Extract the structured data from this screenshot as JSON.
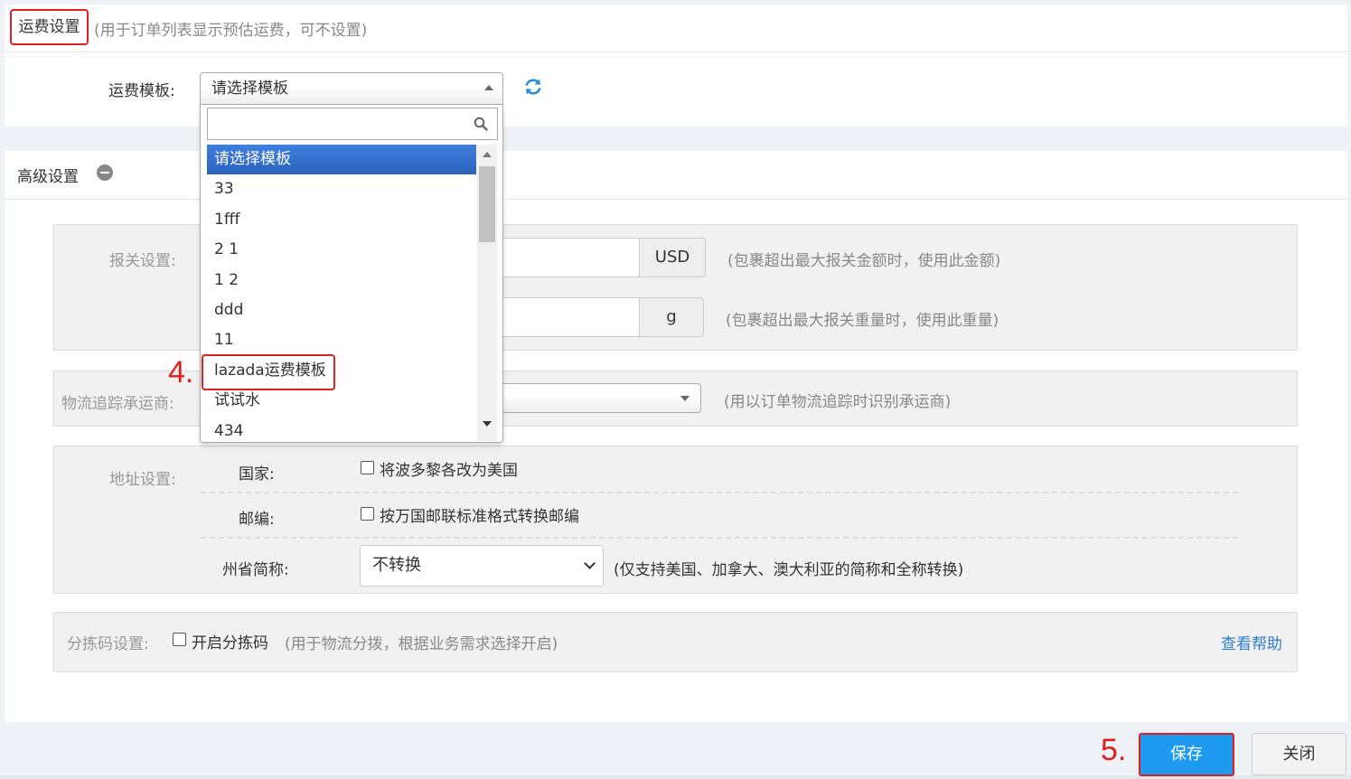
{
  "freight": {
    "title": "运费设置",
    "note": "(用于订单列表显示预估运费，可不设置)",
    "template_label": "运费模板:",
    "template_selected": "请选择模板",
    "dropdown": {
      "search_value": "",
      "options": [
        "请选择模板",
        "33",
        "1fff",
        " 2 1",
        " 1 2",
        "ddd",
        "11",
        "lazada运费模板",
        "试试水",
        "434"
      ],
      "selected_index": 0,
      "highlighted_option": "lazada运费模板"
    }
  },
  "advanced": {
    "title": "高级设置",
    "customs": {
      "label": "报关设置:",
      "amount_unit": "USD",
      "amount_note": "(包裹超出最大报关金额时，使用此金额)",
      "weight_unit": "g",
      "weight_note": "(包裹超出最大报关重量时，使用此重量)"
    },
    "carrier": {
      "label": "物流追踪承运商:",
      "note": "(用以订单物流追踪时识别承运商)"
    },
    "address": {
      "label": "地址设置:",
      "country_label": "国家:",
      "country_option": "将波多黎各改为美国",
      "country_checked": false,
      "zip_label": "邮编:",
      "zip_option": "按万国邮联标准格式转换邮编",
      "zip_checked": false,
      "province_label": "州省简称:",
      "province_value": "不转换",
      "province_note": "(仅支持美国、加拿大、澳大利亚的简称和全称转换)"
    },
    "sorting": {
      "label": "分拣码设置:",
      "option": "开启分拣码",
      "checked": false,
      "note": "(用于物流分拨，根据业务需求选择开启)",
      "help": "查看帮助"
    }
  },
  "footer": {
    "save": "保存",
    "close": "关闭"
  },
  "annotations": {
    "step4": "4.",
    "step5": "5."
  },
  "colors": {
    "highlight_red": "#e02020",
    "primary_blue": "#1e9bf0",
    "link_blue": "#2a7fd4",
    "selected_option": "#3875d7"
  }
}
